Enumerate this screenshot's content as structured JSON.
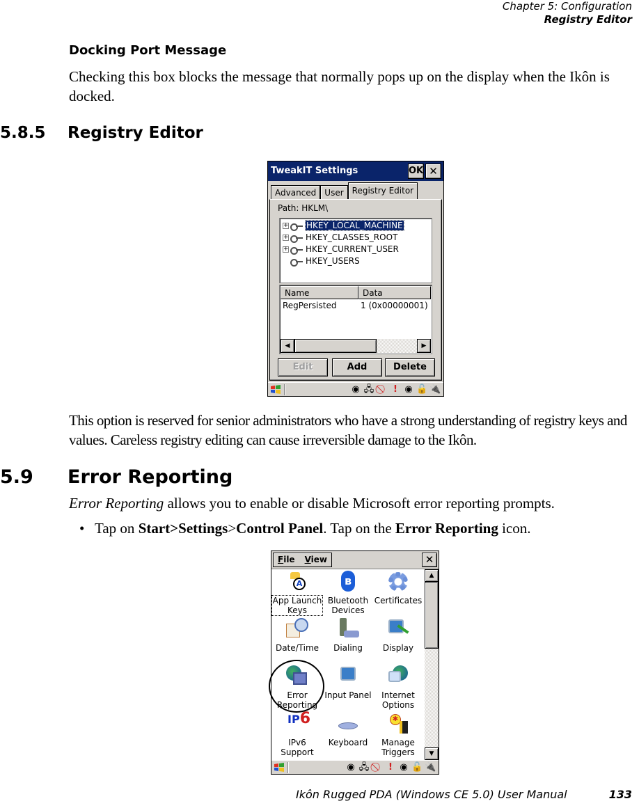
{
  "header": {
    "chapter": "Chapter 5:  Configuration",
    "section": "Registry Editor"
  },
  "docking_port": {
    "heading": "Docking Port Message",
    "body": "Checking this box blocks the message that normally pops up on the display when the Ikôn is docked."
  },
  "section_585": {
    "number": "5.8.5",
    "title": "Registry Editor",
    "body": "This option is reserved for senior administrators who have a strong understanding of registry keys and values. Careless registry editing can cause irreversible damage to the Ikôn."
  },
  "tweakit_screen": {
    "title": "TweakIT Settings",
    "ok_label": "OK",
    "close_label": "✕",
    "tabs": [
      {
        "label": "Advanced",
        "active": false
      },
      {
        "label": "User",
        "active": false
      },
      {
        "label": "Registry Editor",
        "active": true
      }
    ],
    "path_label": "Path: HKLM\\",
    "tree": [
      {
        "label": "HKEY_LOCAL_MACHINE",
        "expandable": true,
        "selected": true
      },
      {
        "label": "HKEY_CLASSES_ROOT",
        "expandable": true,
        "selected": false
      },
      {
        "label": "HKEY_CURRENT_USER",
        "expandable": true,
        "selected": false
      },
      {
        "label": "HKEY_USERS",
        "expandable": false,
        "selected": false
      }
    ],
    "columns": [
      "Name",
      "Data"
    ],
    "rows": [
      {
        "name": "RegPersisted",
        "data": "1 (0x00000001)"
      }
    ],
    "buttons": [
      {
        "label": "Edit",
        "enabled": false
      },
      {
        "label": "Add",
        "enabled": true
      },
      {
        "label": "Delete",
        "enabled": true
      }
    ]
  },
  "section_59": {
    "number": "5.9",
    "title": "Error Reporting",
    "intro_italic": "Error Reporting",
    "intro_rest": " allows you to enable or disable Microsoft error reporting prompts.",
    "bullet": "•",
    "step_parts": {
      "p1": "Tap on ",
      "b1": "Start>Settings",
      "p2": ">",
      "b2": "Control Panel",
      "p3": ". Tap on the ",
      "b3": "Error Reporting",
      "p4": " icon."
    }
  },
  "control_panel_screen": {
    "menu": [
      "File",
      "View"
    ],
    "close_label": "✕",
    "items": [
      {
        "label_line1": "App Launch",
        "label_line2": "Keys",
        "icon": "app-launch-keys-icon",
        "focused": true
      },
      {
        "label_line1": "Bluetooth",
        "label_line2": "Devices",
        "icon": "bluetooth-icon",
        "focused": false
      },
      {
        "label_line1": "Certificates",
        "label_line2": "",
        "icon": "certificates-icon",
        "focused": false
      },
      {
        "label_line1": "Date/Time",
        "label_line2": "",
        "icon": "date-time-icon",
        "focused": false
      },
      {
        "label_line1": "Dialing",
        "label_line2": "",
        "icon": "dialing-icon",
        "focused": false
      },
      {
        "label_line1": "Display",
        "label_line2": "",
        "icon": "display-icon",
        "focused": false
      },
      {
        "label_line1": "Error",
        "label_line2": "Reporting",
        "icon": "error-reporting-icon",
        "focused": false
      },
      {
        "label_line1": "Input Panel",
        "label_line2": "",
        "icon": "input-panel-icon",
        "focused": false
      },
      {
        "label_line1": "Internet",
        "label_line2": "Options",
        "icon": "internet-options-icon",
        "focused": false
      },
      {
        "label_line1": "IPv6",
        "label_line2": "Support",
        "icon": "ipv6-support-icon",
        "focused": false
      },
      {
        "label_line1": "Keyboard",
        "label_line2": "",
        "icon": "keyboard-icon",
        "focused": false
      },
      {
        "label_line1": "Manage",
        "label_line2": "Triggers",
        "icon": "manage-triggers-icon",
        "focused": false
      }
    ]
  },
  "taskbar": {
    "tray_icons": [
      "network-icon",
      "connection-icon",
      "no-signal-icon",
      "alert-icon",
      "network-icon",
      "lock-icon",
      "power-plug-icon"
    ],
    "tray_glyphs": [
      "◉",
      "🖧",
      "⃠",
      "!",
      "◉",
      "🔓",
      "🔌"
    ]
  },
  "footer": {
    "title": "Ikôn Rugged PDA (Windows CE 5.0) User Manual",
    "page": "133"
  }
}
